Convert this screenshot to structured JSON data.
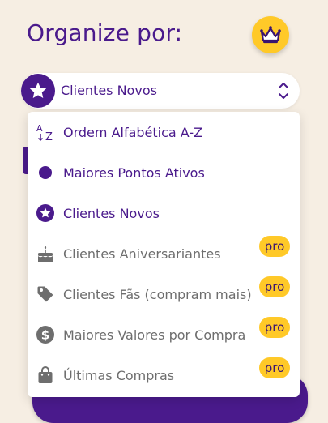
{
  "header": {
    "title": "Organize por:"
  },
  "select": {
    "selected_label": "Clientes Novos"
  },
  "menu": {
    "items": [
      {
        "label": "Ordem Alfabética A-Z",
        "icon": "sort-alpha-icon",
        "pro": false
      },
      {
        "label": "Maiores Pontos Ativos",
        "icon": "dot-icon",
        "pro": false
      },
      {
        "label": "Clientes Novos",
        "icon": "star-badge-icon",
        "pro": false
      },
      {
        "label": "Clientes Aniversariantes",
        "icon": "cake-icon",
        "pro": true
      },
      {
        "label": "Clientes Fãs (compram mais)",
        "icon": "tag-icon",
        "pro": true
      },
      {
        "label": "Maiores Valores por Compra",
        "icon": "dollar-icon",
        "pro": true
      },
      {
        "label": "Últimas Compras",
        "icon": "shopping-bag-icon",
        "pro": true
      }
    ],
    "pro_label": "pro"
  },
  "colors": {
    "primary": "#4a1a8c",
    "accent": "#ffc928",
    "background": "#f6eee3",
    "muted": "#6e6e6e"
  }
}
